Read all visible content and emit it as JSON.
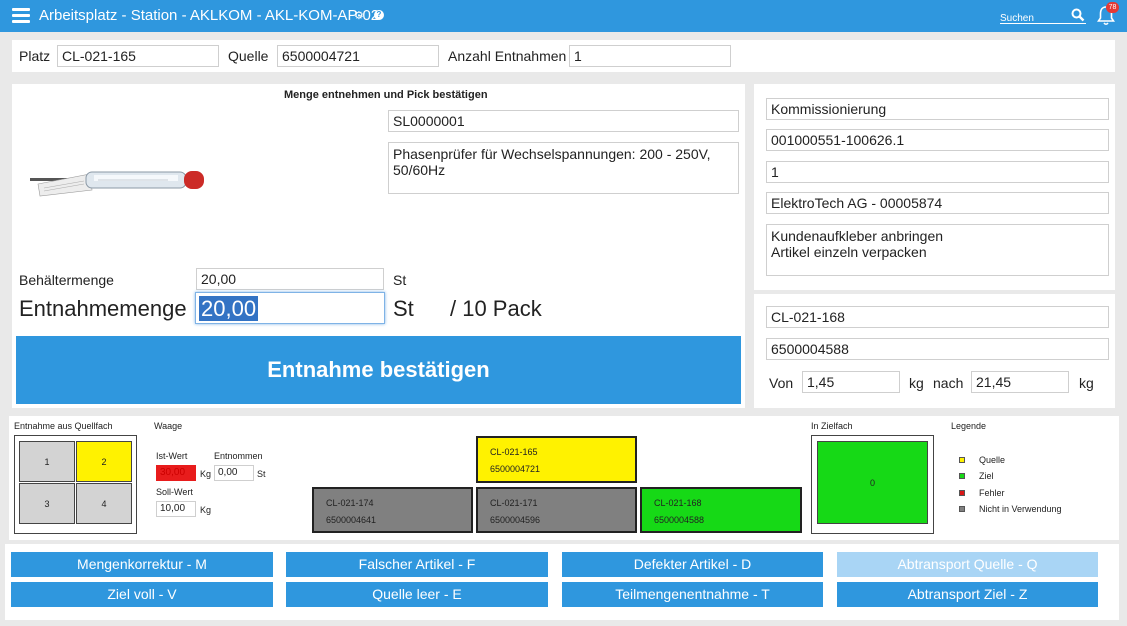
{
  "header": {
    "title": "Arbeitsplatz - Station - AKLKOM - AKL-KOM-AP-02",
    "search_placeholder": "Suchen",
    "notification_count": "78"
  },
  "top_fields": {
    "platz_label": "Platz",
    "platz_value": "CL-021-165",
    "quelle_label": "Quelle",
    "quelle_value": "6500004721",
    "anzahl_label": "Anzahl Entnahmen",
    "anzahl_value": "1"
  },
  "pick": {
    "heading": "Menge entnehmen und Pick bestätigen",
    "article_number": "SL0000001",
    "article_description": "Phasenprüfer für Wechselspannungen: 200 - 250V, 50/60Hz",
    "behaelter_label": "Behältermenge",
    "behaelter_value": "20,00",
    "behaelter_unit": "St",
    "entnahme_label": "Entnahmemenge",
    "entnahme_value": "20,00",
    "entnahme_unit": "St",
    "pack_info": "/ 10 Pack",
    "confirm_label": "Entnahme bestätigen"
  },
  "order": {
    "type": "Kommissionierung",
    "order_number": "001000551-100626.1",
    "position": "1",
    "customer": "ElektroTech AG - 00005874",
    "notes": "Kundenaufkleber anbringen\nArtikel einzeln verpacken"
  },
  "target": {
    "location": "CL-021-168",
    "container": "6500004588",
    "von_label": "Von",
    "von_value": "1,45",
    "von_unit": "kg",
    "nach_label": "nach",
    "nach_value": "21,45",
    "nach_unit": "kg"
  },
  "source_bin": {
    "title": "Entnahme aus Quellfach",
    "cells": [
      "1",
      "2",
      "3",
      "4"
    ],
    "active_cell": "2"
  },
  "scale": {
    "title": "Waage",
    "ist_label": "Ist-Wert",
    "ist_value": "30,00",
    "ist_unit": "Kg",
    "entnommen_label": "Entnommen",
    "entnommen_value": "0,00",
    "entnommen_unit": "St",
    "soll_label": "Soll-Wert",
    "soll_value": "10,00",
    "soll_unit": "Kg"
  },
  "slots": {
    "source": {
      "location": "CL-021-165",
      "container": "6500004721",
      "color": "#fff200"
    },
    "left": {
      "location": "CL-021-174",
      "container": "6500004641",
      "color": "#808080"
    },
    "middle": {
      "location": "CL-021-171",
      "container": "6500004596",
      "color": "#808080"
    },
    "target": {
      "location": "CL-021-168",
      "container": "6500004588",
      "color": "#16d916"
    }
  },
  "target_bin": {
    "title": "In Zielfach",
    "value": "0"
  },
  "legend": {
    "title": "Legende",
    "items": [
      {
        "label": "Quelle",
        "color": "#fff200"
      },
      {
        "label": "Ziel",
        "color": "#16d916"
      },
      {
        "label": "Fehler",
        "color": "#d91616"
      },
      {
        "label": "Nicht in Verwendung",
        "color": "#808080"
      }
    ]
  },
  "actions": {
    "row1": [
      "Mengenkorrektur - M",
      "Falscher Artikel - F",
      "Defekter Artikel - D",
      "Abtransport Quelle - Q"
    ],
    "row2": [
      "Ziel voll - V",
      "Quelle leer - E",
      "Teilmengenentnahme - T",
      "Abtransport Ziel - Z"
    ]
  },
  "colors": {
    "accent": "#2f97de",
    "disabled": "#a9d5f5",
    "error": "#e81c1c"
  }
}
